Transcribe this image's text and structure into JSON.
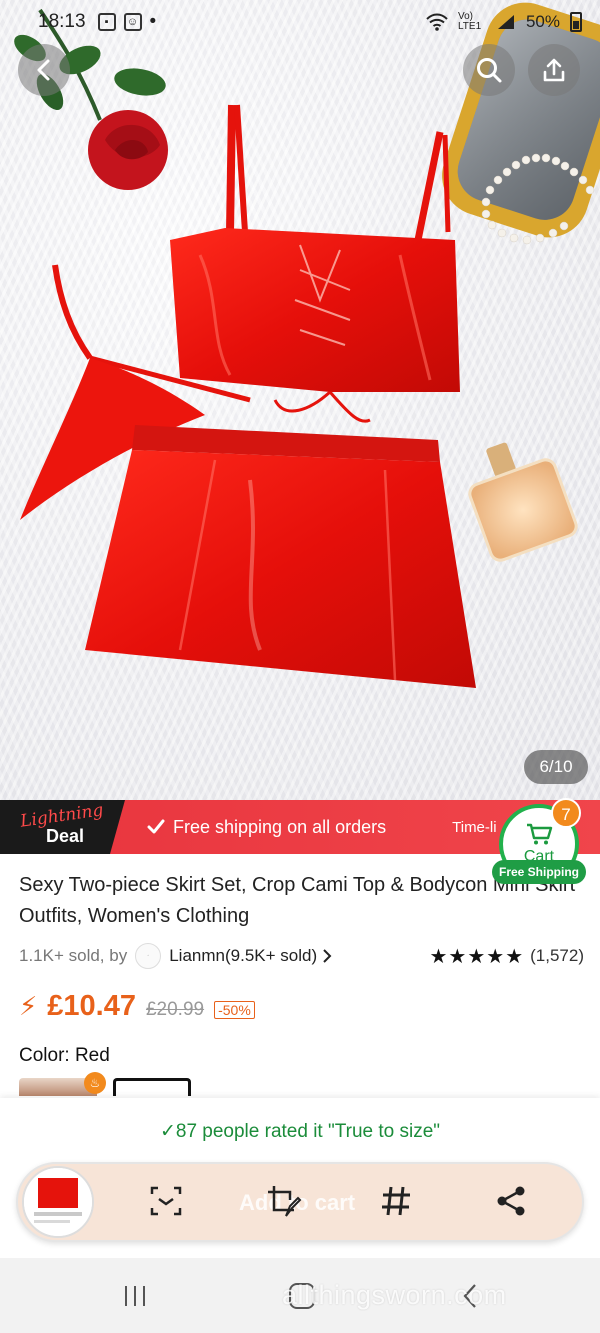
{
  "status_bar": {
    "time": "18:13",
    "battery": "50%",
    "network": "Vo) LTE1"
  },
  "gallery": {
    "counter": "6/10"
  },
  "deal_banner": {
    "logo_line1": "Lightning",
    "logo_line2": "Deal",
    "shipping_text": "Free shipping on all orders",
    "time_text": "Time-li"
  },
  "cart": {
    "badge_count": "7",
    "label": "Cart",
    "free_shipping": "Free Shipping"
  },
  "product": {
    "title": "Sexy Two-piece Skirt Set, Crop Cami Top & Bodycon Mini Skirt Outfits, Women's Clothing",
    "sold": "1.1K+ sold, by",
    "seller": "Lianmn(9.5K+ sold)",
    "stars": "★★★★★",
    "rating_count": "(1,572)",
    "price": "£10.47",
    "old_price": "£20.99",
    "discount": "-50%",
    "color_label": "Color: Red"
  },
  "fit": {
    "text": "87 people rated it \"True to size\""
  },
  "action_bar": {
    "add_to_cart": "Add to cart"
  },
  "watermark": "allthingsworn.com",
  "colors": {
    "accent_red": "#e8343d",
    "price_orange": "#e8611a",
    "green": "#22b14c"
  }
}
